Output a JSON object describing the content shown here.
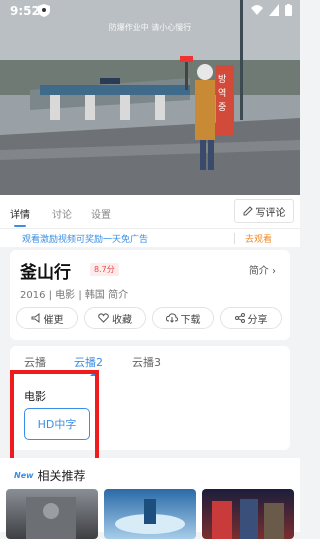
{
  "status": {
    "time": "9:52"
  },
  "video": {
    "subtitle": "防爆作业中 请小心慢行"
  },
  "tabs": [
    {
      "label": "详情"
    },
    {
      "label": "讨论"
    },
    {
      "label": "设置"
    }
  ],
  "comment_button": "写评论",
  "ad": {
    "text": "观看激励视频可奖励一天免广告",
    "link": "去观看"
  },
  "movie": {
    "title": "釜山行",
    "score": "8.7分",
    "intro_link": "简介",
    "meta": "2016 | 电影 | 韩国 简介"
  },
  "actions": [
    {
      "label": "催更"
    },
    {
      "label": "收藏"
    },
    {
      "label": "下载"
    },
    {
      "label": "分享"
    }
  ],
  "sources": {
    "tabs": [
      {
        "label": "云播"
      },
      {
        "label": "云播2"
      },
      {
        "label": "云播3"
      }
    ],
    "category": "电影",
    "episode": "HD中字"
  },
  "recommend": {
    "title": "相关推荐",
    "icon_text": "New"
  },
  "colors": {
    "accent": "#3a8ee6",
    "highlight": "#ee1c1c",
    "score": "#e94b4b",
    "ad_link": "#f08a2b"
  }
}
